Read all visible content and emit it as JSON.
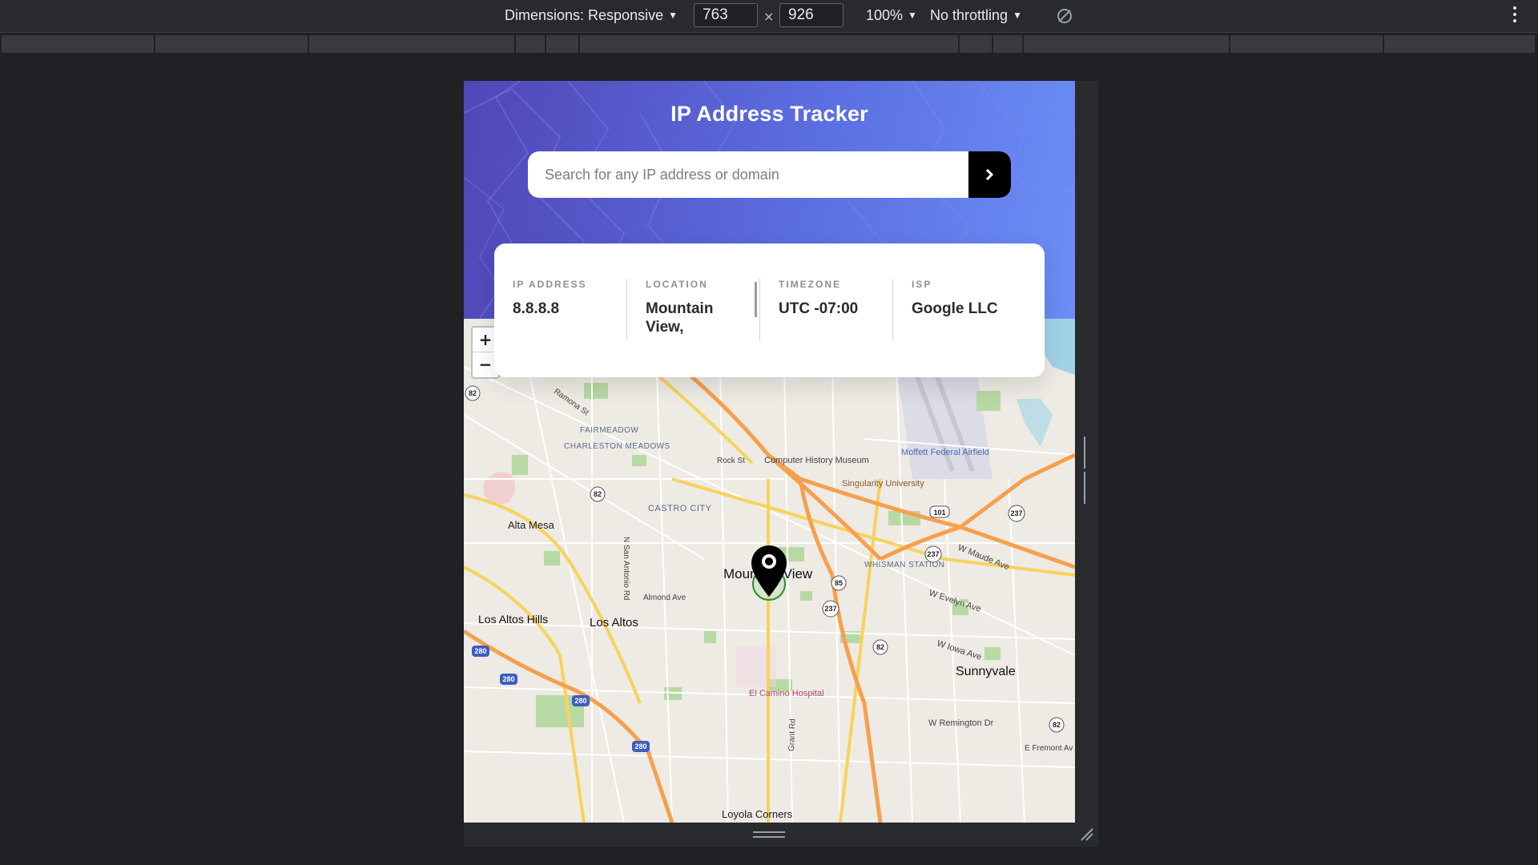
{
  "devtools": {
    "dimensions_label": "Dimensions: Responsive",
    "width_value": "763",
    "times_symbol": "×",
    "height_value": "926",
    "zoom_label": "100%",
    "throttling_label": "No throttling",
    "caret": "▼"
  },
  "app": {
    "title": "IP Address Tracker",
    "search": {
      "placeholder": "Search for any IP address or domain",
      "value": ""
    },
    "info": {
      "ip_label": "IP ADDRESS",
      "ip_value": "8.8.8.8",
      "location_label": "LOCATION",
      "location_value": "Mountain View,",
      "timezone_label": "TIMEZONE",
      "timezone_value": "UTC -07:00",
      "isp_label": "ISP",
      "isp_value": "Google LLC"
    }
  },
  "map": {
    "zoom_in": "+",
    "zoom_out": "−",
    "labels": {
      "mountain_view": "Mountain View",
      "los_altos": "Los Altos",
      "los_altos_hills": "Los Altos Hills",
      "sunnyvale": "Sunnyvale",
      "alta_mesa": "Alta Mesa",
      "castro_city": "CASTRO CITY",
      "whisman_station": "WHISMAN STATION",
      "fairmeadow": "FAIRMEADOW",
      "charleston_meadows": "CHARLESTON MEADOWS",
      "moffett_field": "Moffett Federal Airfield",
      "computer_museum": "Computer History Museum",
      "singularity": "Singularity University",
      "el_camino_hospital": "El Camino Hospital",
      "loyola_corners": "Loyola Corners",
      "rock_st": "Rock St",
      "almond_ave": "Almond Ave",
      "w_evelyn_ave": "W Evelyn Ave",
      "w_iowa_ave": "W Iowa Ave",
      "w_remington_dr": "W Remington Dr",
      "w_maude_ave": "W Maude Ave",
      "ramona_st": "Ramona St",
      "san_antonio_rd": "N San Antonio Rd",
      "grant_rd": "Grant Rd",
      "e_fremont_av": "E Fremont Av"
    },
    "route_shields": {
      "r82": "82",
      "r85": "85",
      "r101": "101",
      "r237": "237",
      "r280": "280"
    },
    "colors": {
      "highway": "#f6a04d",
      "arterial": "#f7d35c",
      "park": "#b7d9a4",
      "water": "#9fd3e6"
    }
  }
}
